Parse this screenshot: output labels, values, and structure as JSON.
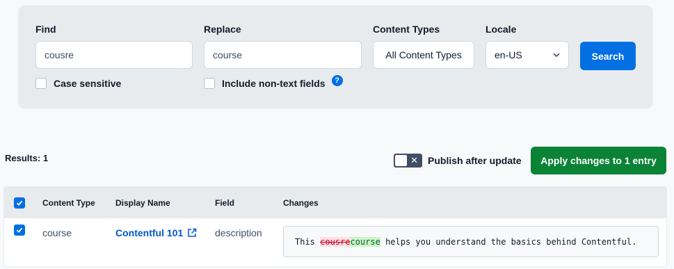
{
  "search": {
    "find_label": "Find",
    "find_value": "cousre",
    "replace_label": "Replace",
    "replace_value": "course",
    "content_types_label": "Content Types",
    "content_types_value": "All Content Types",
    "locale_label": "Locale",
    "locale_value": "en-US",
    "search_button": "Search",
    "case_sensitive_label": "Case sensitive",
    "non_text_label": "Include non-text fields",
    "help_icon_glyph": "?"
  },
  "results": {
    "count_label": "Results: 1",
    "publish_label": "Publish after update",
    "toggle_glyph": "✕",
    "apply_button": "Apply changes to 1 entry"
  },
  "table": {
    "headers": [
      "Content Type",
      "Display Name",
      "Field",
      "Changes"
    ],
    "rows": [
      {
        "content_type": "course",
        "display_name": "Contentful 101",
        "field": "description",
        "change_prefix": "This ",
        "change_removed": "cousre",
        "change_added": "course",
        "change_suffix": " helps you understand the basics behind Contentful."
      }
    ]
  },
  "colors": {
    "primary": "#036fe3",
    "positive": "#0a8337",
    "panel": "#e7ebee",
    "removed": "#bd002a",
    "added": "#006130"
  }
}
